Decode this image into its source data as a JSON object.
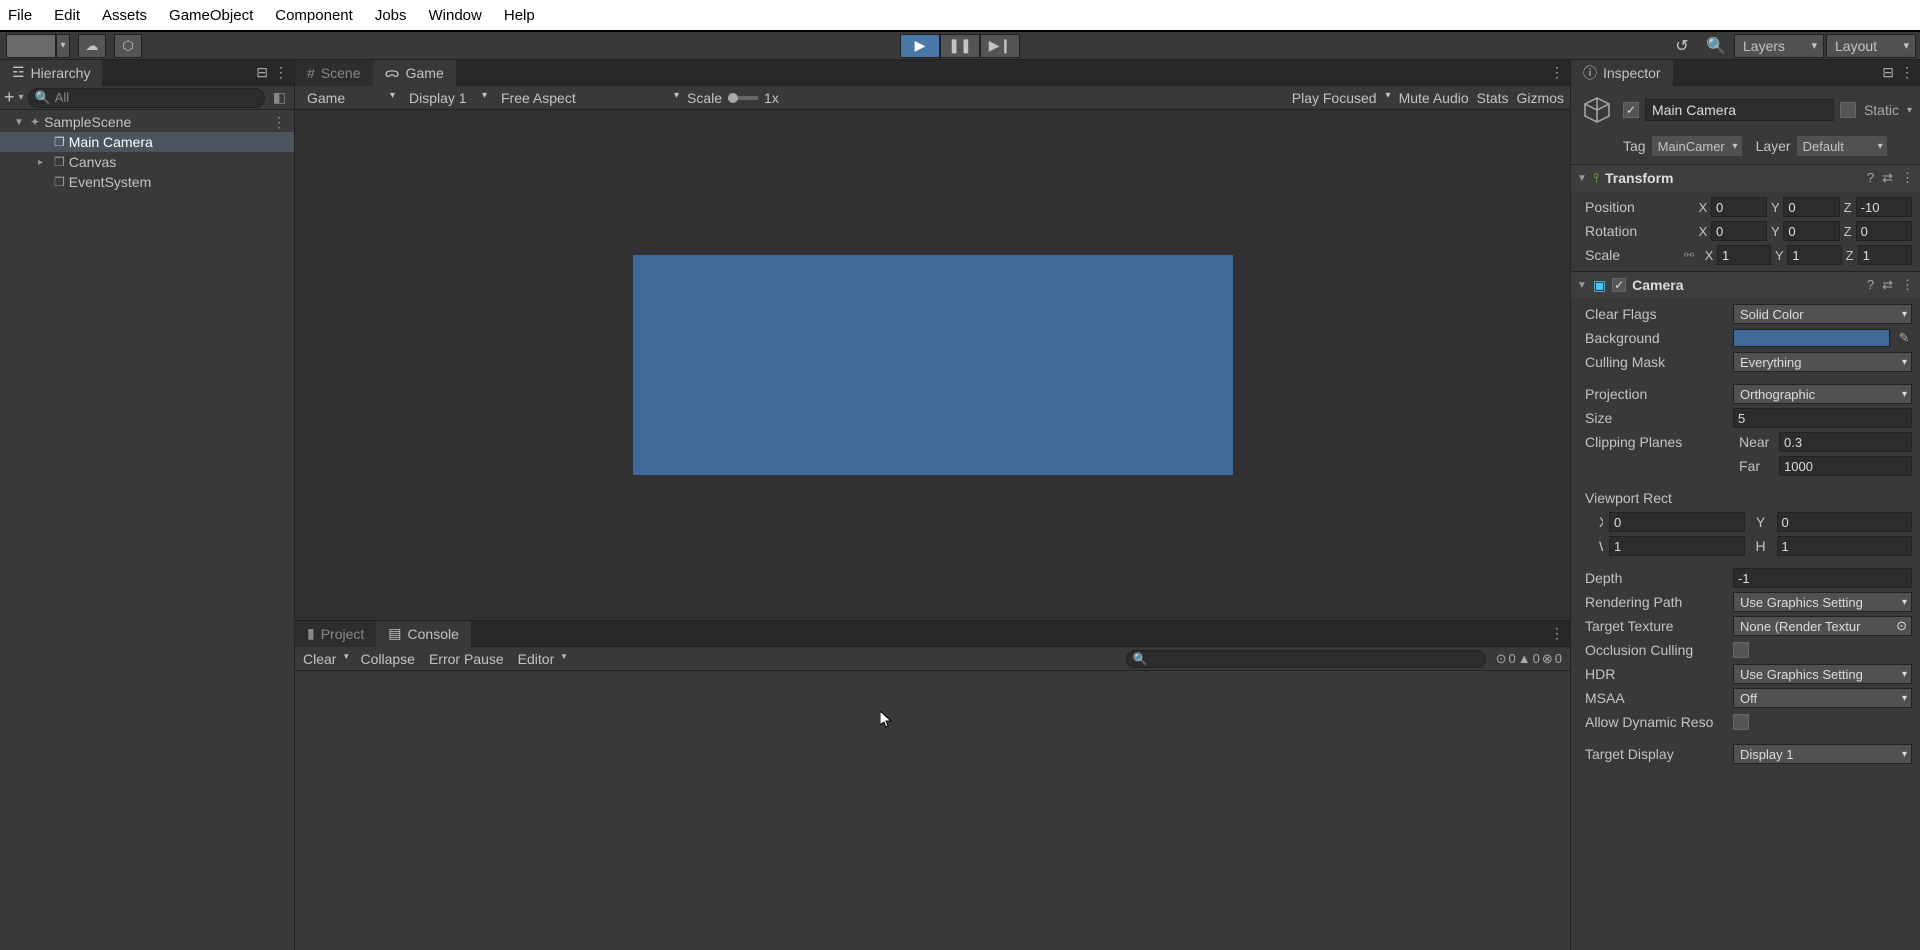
{
  "menu": {
    "file": "File",
    "edit": "Edit",
    "assets": "Assets",
    "gameobject": "GameObject",
    "component": "Component",
    "jobs": "Jobs",
    "window": "Window",
    "help": "Help"
  },
  "toolbar": {
    "layers": "Layers",
    "layout": "Layout"
  },
  "hierarchy": {
    "title": "Hierarchy",
    "search_ph": "All",
    "scene": "SampleScene",
    "items": [
      "Main Camera",
      "Canvas",
      "EventSystem"
    ]
  },
  "tabs": {
    "scene": "Scene",
    "game": "Game",
    "project": "Project",
    "console": "Console"
  },
  "game_toolbar": {
    "mode": "Game",
    "display": "Display 1",
    "aspect": "Free Aspect",
    "scale_lbl": "Scale",
    "scale_val": "1x",
    "focus": "Play Focused",
    "mute": "Mute Audio",
    "stats": "Stats",
    "gizmos": "Gizmos"
  },
  "console": {
    "clear": "Clear",
    "collapse": "Collapse",
    "errpause": "Error Pause",
    "editor": "Editor",
    "info": "0",
    "warn": "0",
    "err": "0"
  },
  "inspector": {
    "title": "Inspector",
    "go_name": "Main Camera",
    "static": "Static",
    "tag_lbl": "Tag",
    "tag": "MainCamer",
    "layer_lbl": "Layer",
    "layer": "Default",
    "transform": {
      "title": "Transform",
      "position": "Position",
      "rotation": "Rotation",
      "scale": "Scale",
      "pos": {
        "x": "0",
        "y": "0",
        "z": "-10"
      },
      "rot": {
        "x": "0",
        "y": "0",
        "z": "0"
      },
      "scl": {
        "x": "1",
        "y": "1",
        "z": "1"
      }
    },
    "camera": {
      "title": "Camera",
      "clear_flags_lbl": "Clear Flags",
      "clear_flags": "Solid Color",
      "background_lbl": "Background",
      "culling_lbl": "Culling Mask",
      "culling": "Everything",
      "projection_lbl": "Projection",
      "projection": "Orthographic",
      "size_lbl": "Size",
      "size": "5",
      "clip_lbl": "Clipping Planes",
      "near_lbl": "Near",
      "near": "0.3",
      "far_lbl": "Far",
      "far": "1000",
      "viewport_lbl": "Viewport Rect",
      "vx": "0",
      "vy": "0",
      "vw": "1",
      "vh": "1",
      "depth_lbl": "Depth",
      "depth": "-1",
      "render_lbl": "Rendering Path",
      "render": "Use Graphics Setting",
      "tex_lbl": "Target Texture",
      "tex": "None (Render Textur",
      "occl_lbl": "Occlusion Culling",
      "hdr_lbl": "HDR",
      "hdr": "Use Graphics Setting",
      "msaa_lbl": "MSAA",
      "msaa": "Off",
      "dyn_lbl": "Allow Dynamic Reso",
      "disp_lbl": "Target Display",
      "disp": "Display 1"
    }
  }
}
